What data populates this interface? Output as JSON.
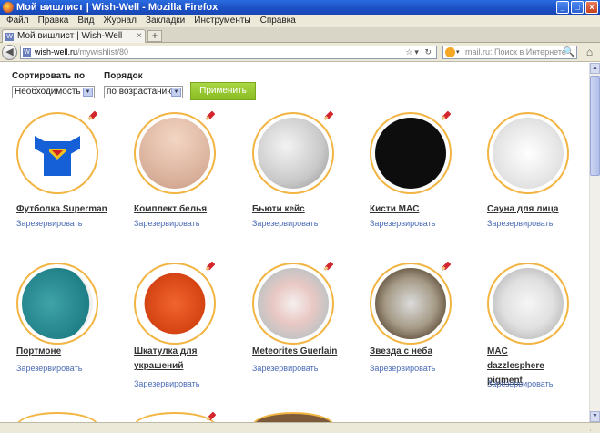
{
  "window": {
    "title": "Мой вишлист | Wish-Well - Mozilla Firefox"
  },
  "menu": [
    "Файл",
    "Правка",
    "Вид",
    "Журнал",
    "Закладки",
    "Инструменты",
    "Справка"
  ],
  "tab": {
    "title": "Мой вишлист | Wish-Well"
  },
  "address": {
    "host": "wish-well.ru",
    "path": "/mywishlist/80"
  },
  "search": {
    "placeholder": "mail.ru: Поиск в Интернете"
  },
  "filters": {
    "sort_label": "Сортировать по",
    "sort_value": "Необходимость",
    "order_label": "Порядок",
    "order_value": "по возрастанию",
    "apply_label": "Применить"
  },
  "items": [
    {
      "title": "Футболка Superman",
      "reserve": "Зарезервировать"
    },
    {
      "title": "Комплект белья",
      "reserve": "Зарезервировать"
    },
    {
      "title": "Бьюти кейс",
      "reserve": "Зарезервировать"
    },
    {
      "title": "Кисти MAC",
      "reserve": "Зарезервировать"
    },
    {
      "title": "Сауна для лица",
      "reserve": "Зарезервировать"
    },
    {
      "title": "Портмоне",
      "reserve": "Зарезервировать"
    },
    {
      "title": "Шкатулка для украшений",
      "reserve": "Зарезервировать"
    },
    {
      "title": "Meteorites Guerlain",
      "reserve": "Зарезервировать"
    },
    {
      "title": "Звезда с неба",
      "reserve": "Зарезервировать"
    },
    {
      "title": "MAC dazzlesphere pigment",
      "reserve": "Зарезервировать"
    }
  ],
  "colors": {
    "accent_border": "#f2b543",
    "apply_button": "#97c732",
    "link": "#4a6bb5",
    "pin": "#d3262f"
  }
}
